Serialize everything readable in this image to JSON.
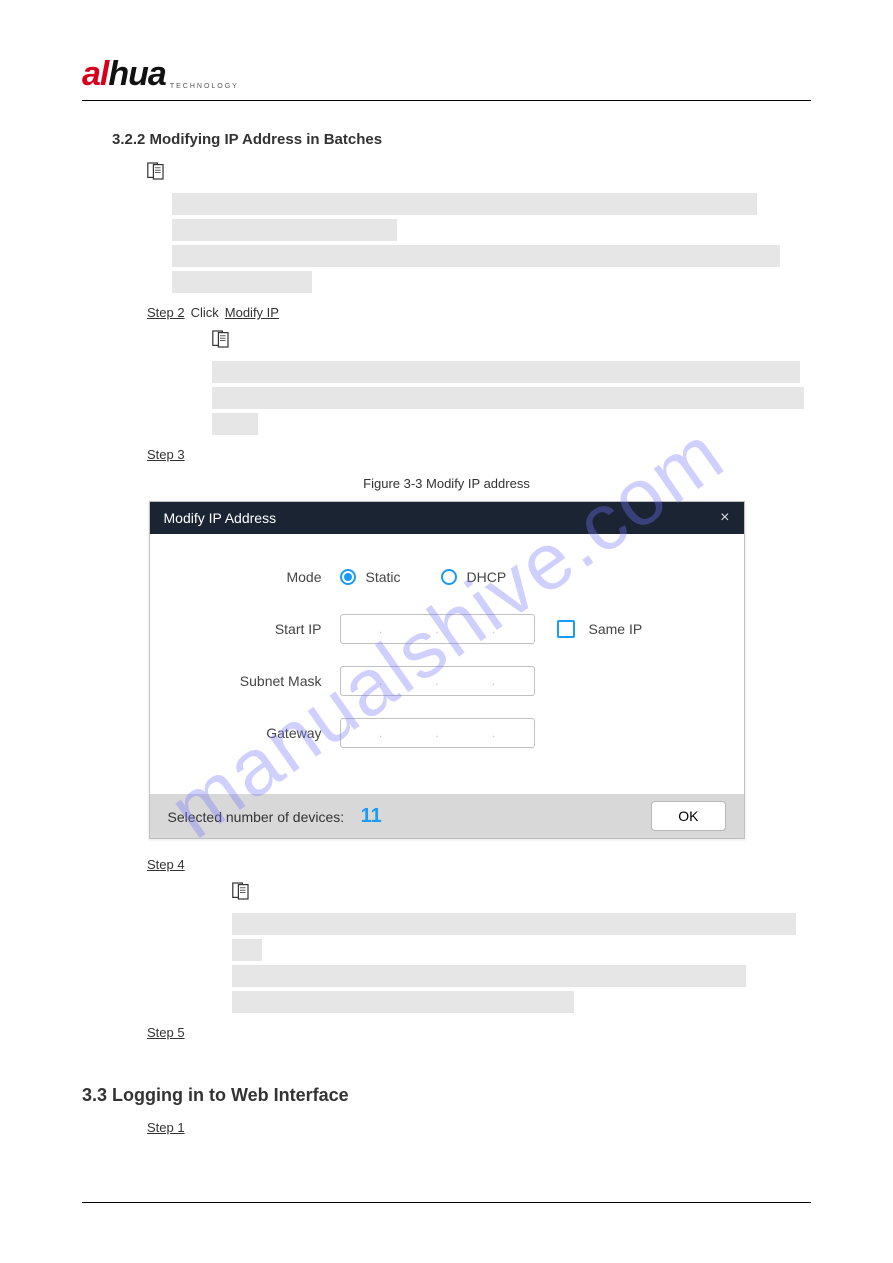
{
  "logo": {
    "prefix_a": "a",
    "prefix_l": "l",
    "rest": "hua",
    "sub": "TECHNOLOGY"
  },
  "section_title": "3.2.2 Modifying IP Address in Batches",
  "step2": {
    "a": "Step 2",
    "b": "Click",
    "c": "Modify IP"
  },
  "step3": "Step 3",
  "figure_caption": "Figure 3-3 Modify IP address",
  "dialog": {
    "title": "Modify IP Address",
    "mode_label": "Mode",
    "static": "Static",
    "dhcp": "DHCP",
    "start_ip": "Start IP",
    "same_ip": "Same IP",
    "subnet": "Subnet Mask",
    "gateway": "Gateway",
    "selected_text": "Selected number of devices:",
    "selected_num": "11",
    "ok": "OK"
  },
  "step4": "Step 4",
  "step5": "Step 5",
  "login_title": "3.3 Logging in to Web Interface",
  "login_step1_a": "Step 1",
  "watermark": "manualshive.com"
}
